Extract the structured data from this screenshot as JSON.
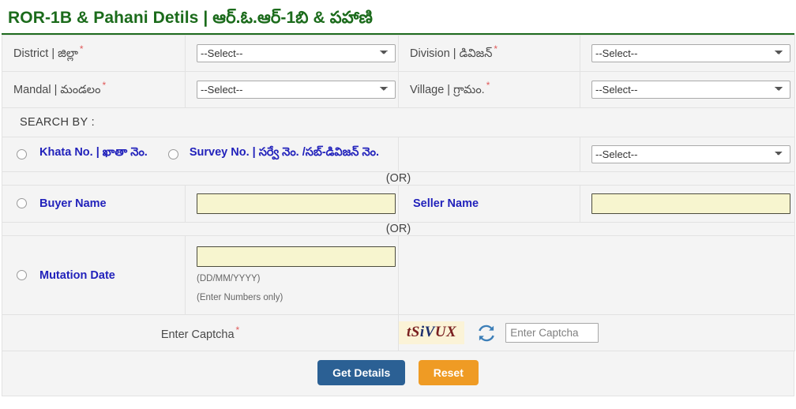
{
  "header": {
    "title": "ROR-1B & Pahani Detils | ఆర్.ఓ.ఆర్-1బి & పహాణి",
    "accent_color": "#1b6b1b"
  },
  "form": {
    "rows": [
      {
        "left_label": "District | జిల్లా",
        "left_required": "*",
        "left_select_value": "--Select--",
        "right_label": "Division | డివిజన్",
        "right_required": "*",
        "right_select_value": "--Select--"
      },
      {
        "left_label": "Mandal | మండలం",
        "left_required": "*",
        "left_select_value": "--Select--",
        "right_label": "Village | గ్రామం.",
        "right_required": "*",
        "right_select_value": "--Select--"
      }
    ]
  },
  "search_by": {
    "heading": "SEARCH BY :",
    "khata_label": "Khata No. | ఖాతా నెం.",
    "survey_label": "Survey No. | సర్వే నెం. /సబ్-డివిజన్ నెం.",
    "survey_select_value": "--Select--",
    "or_text_1": "(OR)",
    "buyer_label": "Buyer Name",
    "buyer_value": "",
    "buyer_placeholder": "",
    "seller_label": "Seller Name",
    "seller_value": "",
    "seller_placeholder": "",
    "or_text_2": "(OR)",
    "mutation_label": "Mutation Date",
    "mutation_value": "",
    "mutation_placeholder": "",
    "mutation_hint_1": "(DD/MM/YYYY)",
    "mutation_hint_2": "(Enter Numbers only)"
  },
  "captcha": {
    "label": "Enter Captcha",
    "required": "*",
    "image_text": "tSiVUX",
    "image_part_1": "tS",
    "image_part_2": "iV",
    "image_part_3": "UX",
    "refresh_icon": "refresh-icon",
    "input_value": "",
    "input_placeholder": "Enter Captcha"
  },
  "actions": {
    "submit_label": "Get Details",
    "reset_label": "Reset",
    "submit_color": "#2b6094",
    "reset_color": "#ef9b24"
  }
}
